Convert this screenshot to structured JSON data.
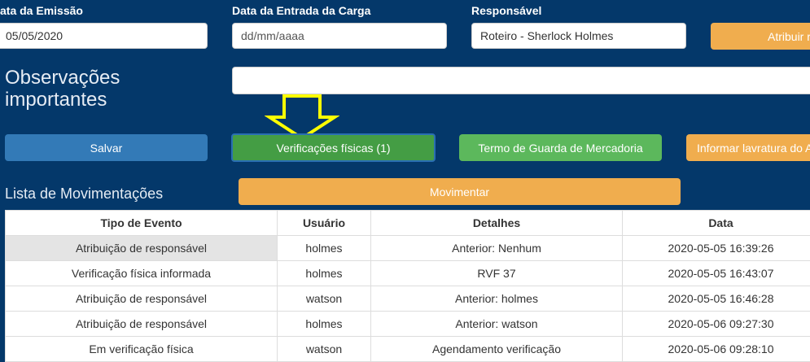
{
  "form": {
    "emissao_label": "ata da Emissão",
    "emissao_value": "05/05/2020",
    "entrada_label": "Data da Entrada da Carga",
    "entrada_placeholder": "dd/mm/aaaa",
    "responsavel_label": "Responsável",
    "responsavel_value": "Roteiro - Sherlock Holmes",
    "atribuir_label": "Atribuir r",
    "obs_label": "Observações importantes",
    "obs_value": ""
  },
  "actions": {
    "salvar": "Salvar",
    "verificacoes": "Verificações físicas (1)",
    "termo": "Termo de Guarda de Mercadoria",
    "informar": "Informar lavratura do A"
  },
  "annotation": {
    "arrow_color": "#ffff00",
    "icon": "arrow-down-icon"
  },
  "movimentacoes": {
    "title": "Lista de Movimentações",
    "movimentar_label": "Movimentar",
    "headers": [
      "Tipo de Evento",
      "Usuário",
      "Detalhes",
      "Data"
    ],
    "rows": [
      [
        "Atribuição de responsável",
        "holmes",
        "Anterior: Nenhum",
        "2020-05-05 16:39:26"
      ],
      [
        "Verificação física informada",
        "holmes",
        "RVF 37",
        "2020-05-05 16:43:07"
      ],
      [
        "Atribuição de responsável",
        "watson",
        "Anterior: holmes",
        "2020-05-05 16:46:28"
      ],
      [
        "Atribuição de responsável",
        "holmes",
        "Anterior: watson",
        "2020-05-06 09:27:30"
      ],
      [
        "Em verificação física",
        "watson",
        "Agendamento verificação",
        "2020-05-06 09:28:10"
      ]
    ]
  },
  "colors": {
    "background": "#04386a",
    "primary": "#337ab7",
    "success": "#5cb85c",
    "success_active": "#449d44",
    "warning": "#f0ad4e"
  }
}
